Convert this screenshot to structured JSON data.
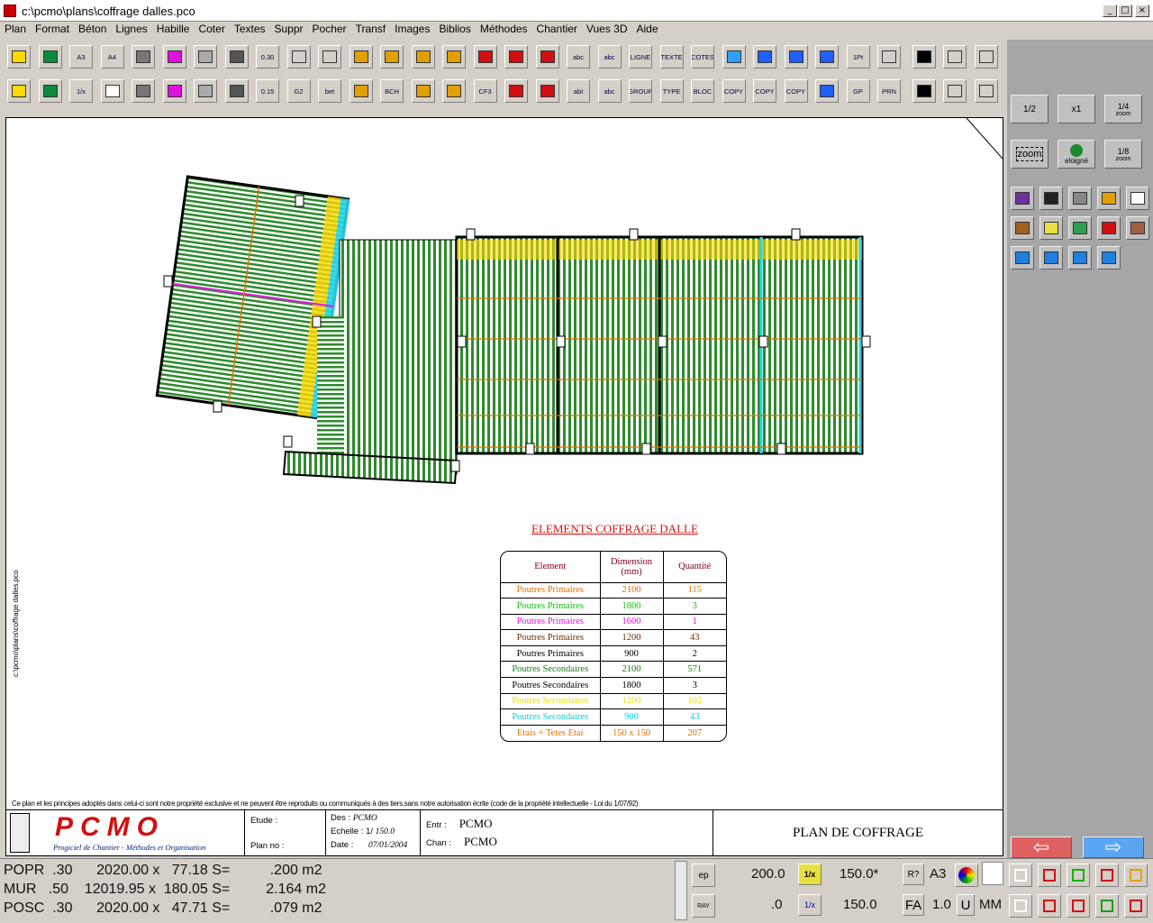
{
  "window": {
    "title": "c:\\pcmo\\plans\\coffrage dalles.pco",
    "controls": [
      "_",
      "□",
      "×"
    ]
  },
  "menu": [
    "Plan",
    "Format",
    "Béton",
    "Lignes",
    "Habille",
    "Coter",
    "Textes",
    "Suppr",
    "Pocher",
    "Transf",
    "Images",
    "Biblios",
    "Méthodes",
    "Chantier",
    "Vues 3D",
    "Aide"
  ],
  "toolbar": {
    "row1": [
      "",
      "",
      "A3",
      "A4",
      "",
      "",
      "",
      "",
      "0.30",
      "",
      "",
      "",
      "",
      "",
      "",
      "",
      "",
      "",
      "abc",
      "abc",
      "LIGNE",
      "TEXTE",
      "COTES",
      "",
      "",
      "",
      "",
      "1Pt",
      "",
      "",
      "",
      ""
    ],
    "row2": [
      "",
      "",
      "1/x",
      "",
      "",
      "",
      "",
      "",
      "0.15",
      "G2",
      "bet",
      "",
      "BCH",
      "",
      "",
      "CF3",
      "",
      "",
      "abI",
      "abc",
      "GROUP",
      "TYPE",
      "BLOC",
      "COPY",
      "COPY",
      "COPY",
      "",
      "GP",
      "PRN",
      "",
      "",
      ""
    ]
  },
  "right_panel": {
    "zoom_half": "1/2",
    "zoom_x1": "x1",
    "zoom_quarter": "1/4",
    "zoom_quarter_sub": "zoom",
    "zoom_btn": "zoom",
    "eloigne": "eloigné",
    "zoom_eighth": "1/8",
    "zoom_eighth_sub": "zoom",
    "accent_left": "#e06060",
    "accent_right": "#5aa6f0"
  },
  "drawing": {
    "table_title": "ELEMENTS COFFRAGE DALLE",
    "headers": [
      "Element",
      "Dimension (mm)",
      "Quantité"
    ],
    "rows": [
      {
        "el": "Poutres Primaires",
        "dim": "2100",
        "qty": "115",
        "color": "#e07000"
      },
      {
        "el": "Poutres Primaires",
        "dim": "1800",
        "qty": "3",
        "color": "#10c010"
      },
      {
        "el": "Poutres Primaires",
        "dim": "1600",
        "qty": "1",
        "color": "#e010e0"
      },
      {
        "el": "Poutres Primaires",
        "dim": "1200",
        "qty": "43",
        "color": "#6a2c00"
      },
      {
        "el": "Poutres Primaires",
        "dim": "900",
        "qty": "2",
        "color": "#000000"
      },
      {
        "el": "Poutres Secondaires",
        "dim": "2100",
        "qty": "571",
        "color": "#1a7a1a"
      },
      {
        "el": "Poutres Secondaires",
        "dim": "1800",
        "qty": "3",
        "color": "#000000"
      },
      {
        "el": "Poutres Secondaires",
        "dim": "1200",
        "qty": "102",
        "color": "#e8e000"
      },
      {
        "el": "Poutres Secondaires",
        "dim": "900",
        "qty": "43",
        "color": "#00d0e0"
      },
      {
        "el": "Etais + Tetes Etai",
        "dim": "150 x 150",
        "qty": "207",
        "color": "#e07000"
      }
    ],
    "disclaimer": "Ce plan et les principes adoptés dans celui-ci sont notre propriété exclusive et ne peuvent être reproduits ou communiqués à des tiers,sans notre autorisation écrite (code de la propriété intellectuelle - Loi du 1/07/92)",
    "side_path": "c:\\pcmo\\plans\\coffrage dalles.pco",
    "cartouche": {
      "logo": "PCMO",
      "logo_sub": "Progiciel de Chantier - Méthodes et Organisation",
      "etude": "Etude :",
      "plan_no": "Plan no :",
      "des_label": "Des :",
      "des_val": "PCMO",
      "echelle_label": "Echelle : 1/",
      "echelle_val": "150.0",
      "date_label": "Date :",
      "date_val": "07/01/2004",
      "entr_label": "Entr :",
      "entr_val": "PCMO",
      "chan_label": "Chan :",
      "chan_val": "PCMO",
      "plan_title": "PLAN DE COFFRAGE"
    }
  },
  "status": {
    "lines": [
      "POPR  .30      2020.00 x   77.18 S=          .200 m2",
      "MUR   .50    12019.95 x  180.05 S=         2.164 m2",
      "POSC  .30      2020.00 x   47.71 S=          .079 m2"
    ],
    "ep": "ep",
    "ray": "RAY",
    "v1": "200.0",
    "v2": "150.0*",
    "v3": ".0",
    "v4": "150.0",
    "inv": "1/x",
    "help": "R?",
    "a3": "A3",
    "fa": "FA",
    "fa_val": "1.0",
    "u": "U",
    "mm": "MM"
  }
}
